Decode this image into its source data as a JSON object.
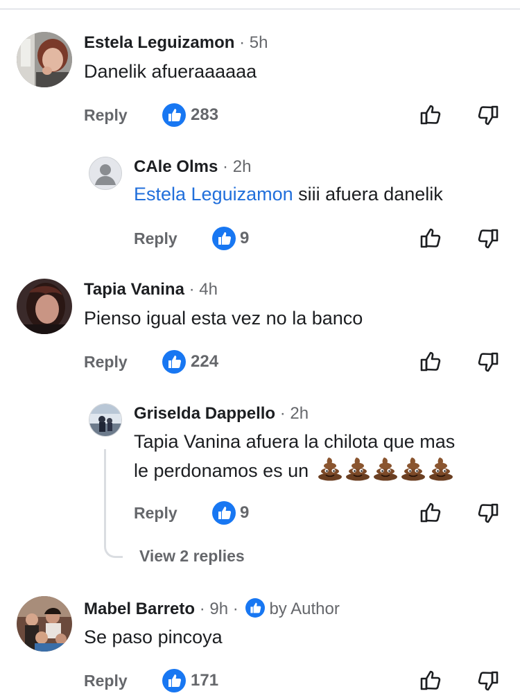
{
  "labels": {
    "reply": "Reply",
    "view_replies": "View 2 replies",
    "separator": "·"
  },
  "icons": {
    "like_badge": "thumbs-up-filled-icon",
    "upvote": "thumbs-up-outline-icon",
    "downvote": "thumbs-down-outline-icon",
    "poop": "pile-of-poo-emoji"
  },
  "colors": {
    "like_blue": "#1877f2",
    "mention_blue": "#216fdb",
    "meta_gray": "#65676b"
  },
  "comments": [
    {
      "author": "Estela Leguizamon",
      "time": "5h",
      "text": "Danelik afueraaaaaa",
      "likes": "283"
    },
    {
      "author": "CAle Olms",
      "time": "2h",
      "mention": "Estela Leguizamon",
      "text": " siii afuera danelik",
      "likes": "9"
    },
    {
      "author": "Tapia Vanina",
      "time": "4h",
      "text": "Pienso igual esta vez no la banco",
      "likes": "224"
    },
    {
      "author": "Griselda Dappello",
      "time": "2h",
      "text_line1": "Tapia Vanina afuera la chilota que mas",
      "text_line2": "le perdonamos  es un",
      "poop_count": 5,
      "likes": "9"
    },
    {
      "author": "Mabel Barreto",
      "time": "9h",
      "badge": "by Author",
      "text": "Se paso pincoya",
      "likes": "171"
    }
  ]
}
